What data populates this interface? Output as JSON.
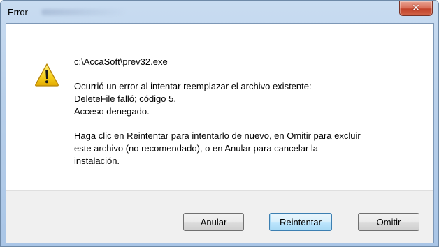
{
  "window": {
    "title": "Error",
    "close_glyph": "✕"
  },
  "icon": {
    "name": "warning-icon"
  },
  "message": {
    "path": "c:\\AccaSoft\\prev32.exe",
    "error_lines": [
      "Ocurrió un error al intentar reemplazar el archivo existente:",
      "DeleteFile falló; código 5.",
      "Acceso denegado."
    ],
    "help_lines": [
      "Haga clic en Reintentar para intentarlo de nuevo, en Omitir para excluir",
      "este archivo (no recomendado), o en Anular para cancelar la",
      "instalación."
    ]
  },
  "buttons": {
    "abort": "Anular",
    "retry": "Reintentar",
    "ignore": "Omitir"
  }
}
